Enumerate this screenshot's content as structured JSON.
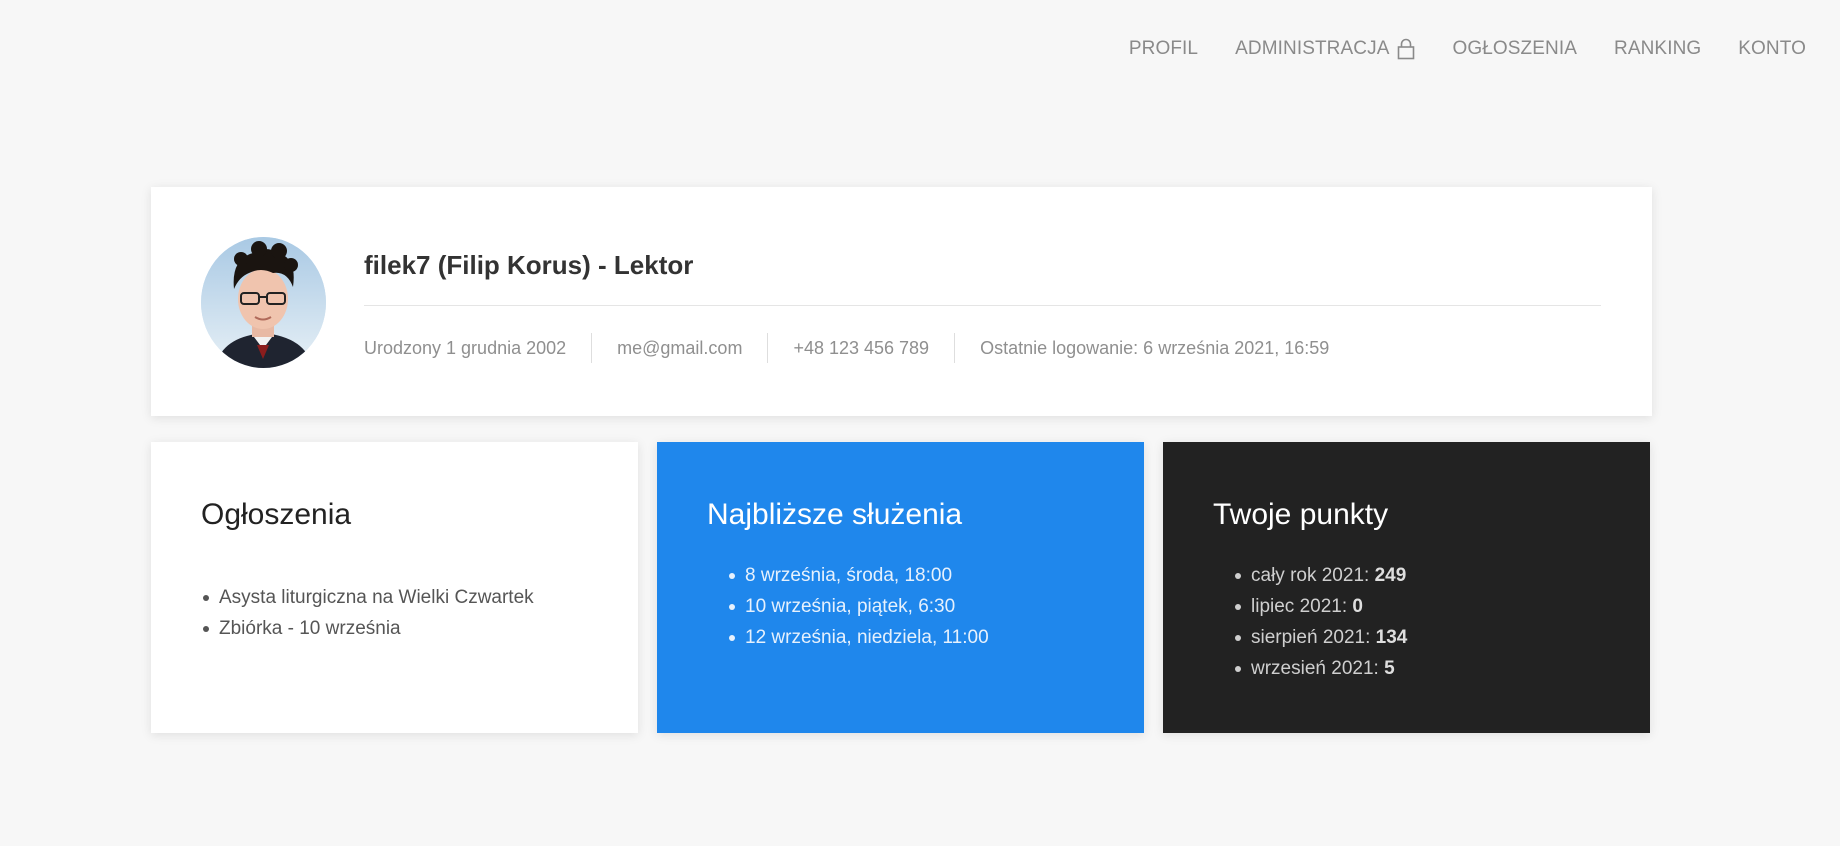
{
  "nav": {
    "items": [
      {
        "label": "PROFIL"
      },
      {
        "label": "ADMINISTRACJA"
      },
      {
        "label": "OGŁOSZENIA"
      },
      {
        "label": "RANKING"
      },
      {
        "label": "KONTO"
      }
    ],
    "locked_icon": "lock-icon"
  },
  "profile": {
    "name": "filek7 (Filip Korus) - Lektor",
    "birth": "Urodzony 1 grudnia 2002",
    "email": "me@gmail.com",
    "phone": "+48 123 456 789",
    "last_login": "Ostatnie logowanie: 6 września 2021, 16:59"
  },
  "announcements": {
    "title": "Ogłoszenia",
    "items": [
      "Asysta liturgiczna na Wielki Czwartek",
      "Zbiórka - 10 września"
    ]
  },
  "services": {
    "title": "Najbliższe służenia",
    "items": [
      "8 września, środa, 18:00",
      "10 września, piątek, 6:30",
      "12 września, niedziela, 11:00"
    ]
  },
  "points": {
    "title": "Twoje punkty",
    "items": [
      {
        "label": "cały rok 2021: ",
        "value": "249"
      },
      {
        "label": "lipiec 2021: ",
        "value": "0"
      },
      {
        "label": "sierpień 2021: ",
        "value": "134"
      },
      {
        "label": "wrzesień 2021: ",
        "value": "5"
      }
    ]
  },
  "colors": {
    "background": "#f7f7f7",
    "blue_card": "#1f87ec",
    "dark_card": "#222222"
  }
}
